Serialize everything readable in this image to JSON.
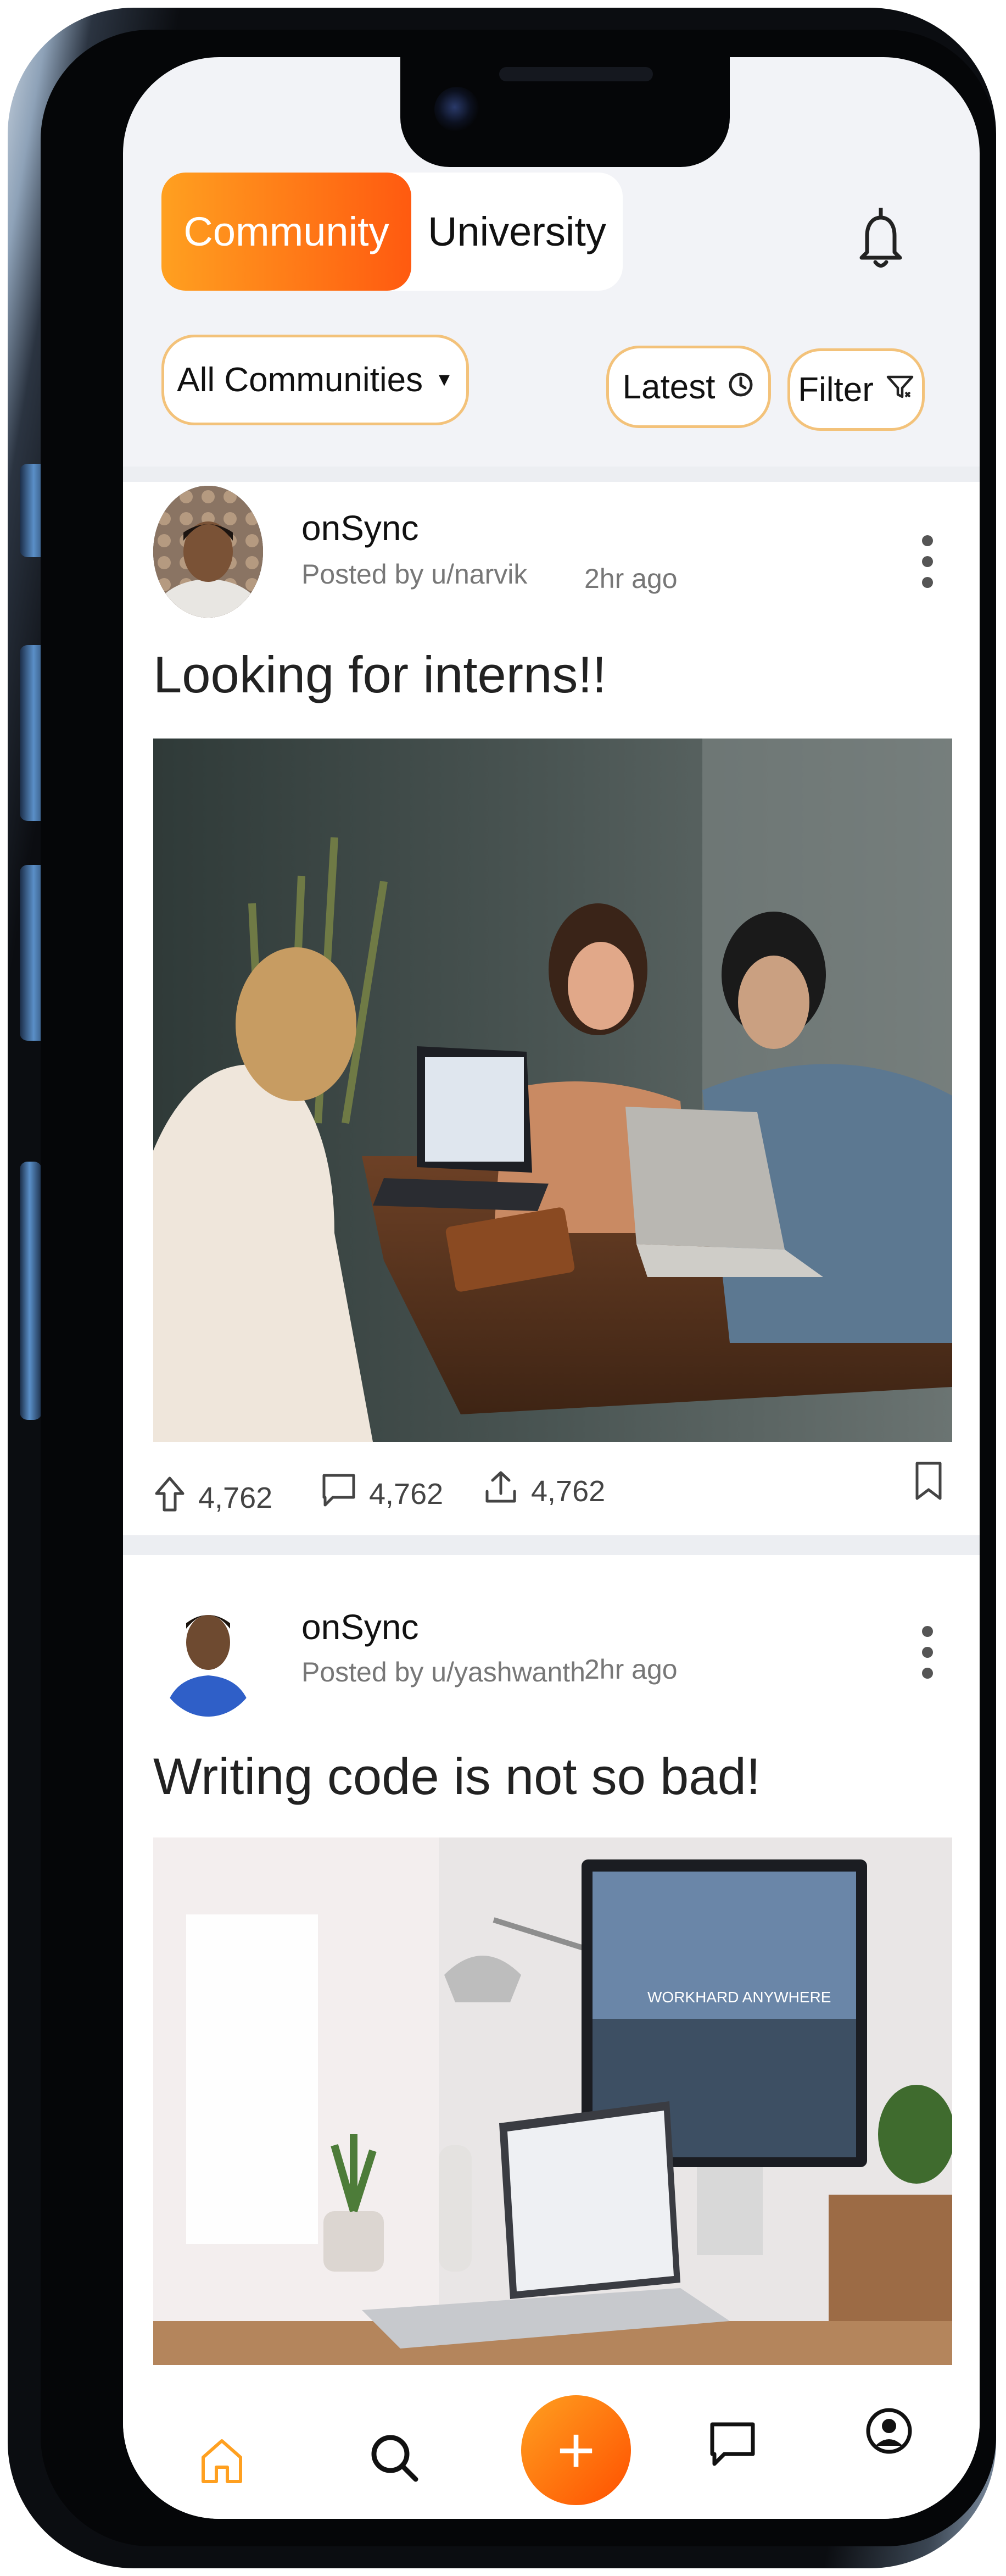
{
  "header": {
    "tabs": [
      {
        "label": "Community",
        "active": true
      },
      {
        "label": "University",
        "active": false
      }
    ],
    "notifications_icon": "bell-icon"
  },
  "filters": {
    "community_select": "All Communities",
    "sort_label": "Latest",
    "sort_icon": "clock-icon",
    "filter_label": "Filter",
    "filter_icon": "funnel-icon"
  },
  "posts": [
    {
      "org": "onSync",
      "posted_by": "Posted by u/narvik",
      "time": "2hr ago",
      "title": "Looking for interns!!",
      "image": "photo of four people meeting at a wooden table with laptops",
      "upvotes": "4,762",
      "comments": "4,762",
      "shares": "4,762"
    },
    {
      "org": "onSync",
      "posted_by": "Posted by u/yashwanth",
      "time": "2hr ago",
      "title": "Writing code is not so bad!",
      "image": "photo of a desk workspace with monitor, laptop and plants",
      "monitor_text": "WORKHARD ANYWHERE"
    }
  ],
  "nav": {
    "items": [
      "home-icon",
      "search-icon",
      "add-icon",
      "chat-icon",
      "profile-icon"
    ],
    "fab_label": "+",
    "active": "home"
  },
  "colors": {
    "accent_start": "#ffa020",
    "accent_end": "#ff5a10",
    "pill_border": "#f3c27a",
    "screen_bg": "#f2f3f7"
  }
}
